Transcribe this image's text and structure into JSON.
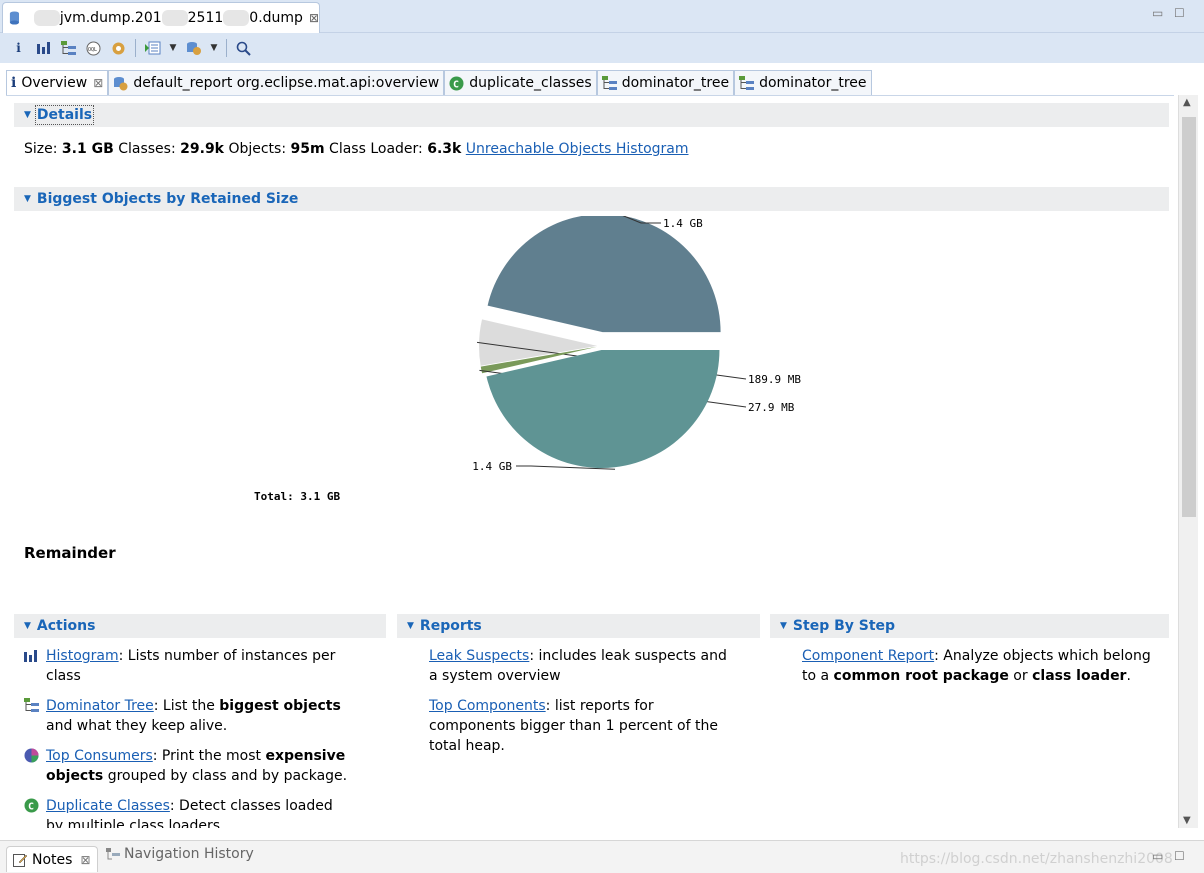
{
  "editor": {
    "tab_title_parts": [
      "jvm.dump.201",
      "2511",
      "0.dump"
    ],
    "close_glyph": "⊠",
    "window_min": "▭",
    "window_max": "☐"
  },
  "toolbar": {
    "items": [
      "info-icon",
      "histogram-icon",
      "dominator-tree-icon",
      "oql-icon",
      "heap-dump-overview-icon",
      "run-expert-report-icon",
      "query-browser-icon",
      "find-object-icon"
    ]
  },
  "page_tabs": [
    {
      "label": "Overview",
      "icon": "info-icon",
      "closable": true
    },
    {
      "label": "default_report  org.eclipse.mat.api:overview",
      "icon": "report-icon"
    },
    {
      "label": "duplicate_classes",
      "icon": "duplicate-classes-icon"
    },
    {
      "label": "dominator_tree",
      "icon": "dominator-tree-icon"
    },
    {
      "label": "dominator_tree",
      "icon": "dominator-tree-icon"
    }
  ],
  "details": {
    "heading": "Details",
    "size_label": "Size:",
    "size_value": "3.1 GB",
    "classes_label": "Classes:",
    "classes_value": "29.9k",
    "objects_label": "Objects:",
    "objects_value": "95m",
    "loader_label": "Class Loader:",
    "loader_value": "6.3k",
    "unreachable_link": "Unreachable Objects Histogram"
  },
  "biggest": {
    "heading": "Biggest Objects by Retained Size",
    "total": "Total: 3.1 GB",
    "remainder": "Remainder"
  },
  "chart_data": {
    "type": "pie",
    "slices": [
      {
        "label": "1.4 GB",
        "value": 1.4,
        "color": "#607f8f"
      },
      {
        "label": "189.9 MB",
        "value": 0.1899,
        "color": "#dcdcdc"
      },
      {
        "label": "27.9 MB",
        "value": 0.0279,
        "color": "#7a9a5a"
      },
      {
        "label": "1.4 GB",
        "value": 1.4,
        "color": "#5f9494"
      }
    ],
    "total_label": "Total: 3.1 GB"
  },
  "actions": {
    "heading": "Actions",
    "histogram_link": "Histogram",
    "histogram_desc": ": Lists number of instances per class",
    "dominator_link": "Dominator Tree",
    "dominator_desc_a": ": List the ",
    "dominator_bold": "biggest objects",
    "dominator_desc_b": " and what they keep alive.",
    "consumers_link": "Top Consumers",
    "consumers_desc_a": ": Print the most ",
    "consumers_bold": "expensive objects",
    "consumers_desc_b": " grouped by class and by package.",
    "duplicates_link": "Duplicate Classes",
    "duplicates_desc": ": Detect classes loaded by multiple class loaders."
  },
  "reports": {
    "heading": "Reports",
    "leak_link": "Leak Suspects",
    "leak_desc": ": includes leak suspects and a system overview",
    "topcomp_link": "Top Components",
    "topcomp_desc": ": list reports for components bigger than 1 percent of the total heap."
  },
  "steps": {
    "heading": "Step By Step",
    "component_link": "Component Report",
    "component_desc_a": ": Analyze objects which belong to a ",
    "component_bold_a": "common root package",
    "component_desc_b": " or ",
    "component_bold_b": "class loader",
    "component_desc_c": "."
  },
  "bottom": {
    "notes_label": "Notes",
    "nav_label": "Navigation History",
    "watermark": "https://blog.csdn.net/zhanshenzhi2008"
  },
  "colors": {
    "accent": "#1a66b8",
    "tabbar": "#dbe6f4",
    "section_bg": "#ecedee"
  }
}
